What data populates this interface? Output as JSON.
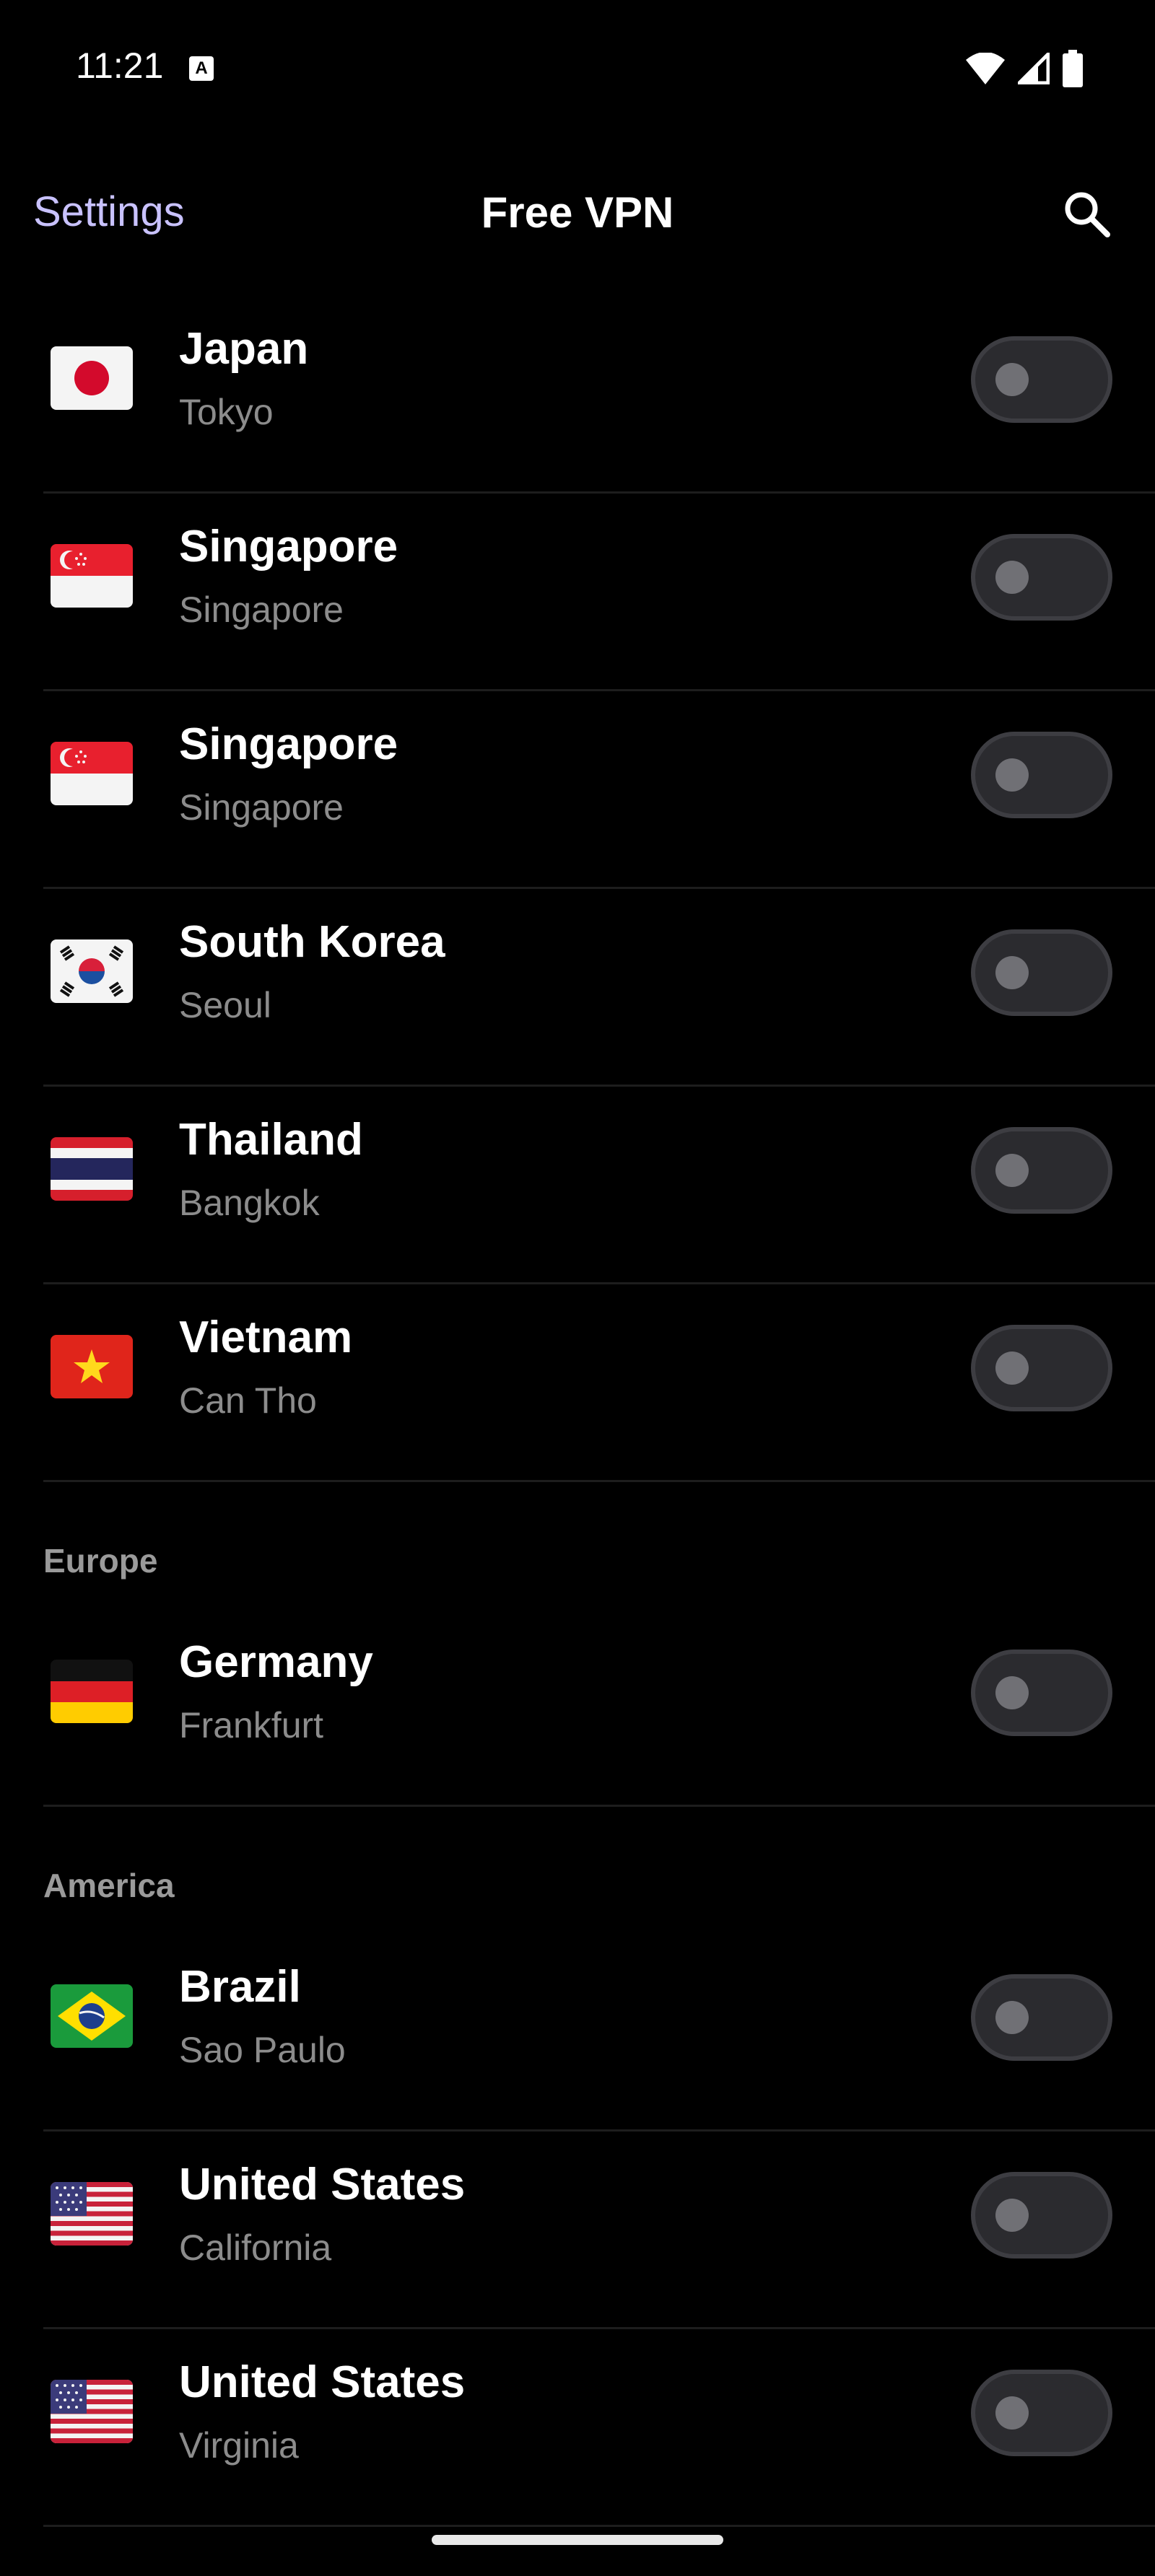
{
  "status_bar": {
    "time": "11:21",
    "notification_glyph": "A"
  },
  "app_bar": {
    "settings_label": "Settings",
    "title": "Free VPN"
  },
  "servers_asia": [
    {
      "country": "Japan",
      "city": "Tokyo",
      "flag": "jp-flag-icon",
      "enabled": false
    },
    {
      "country": "Singapore",
      "city": "Singapore",
      "flag": "sg-flag-icon",
      "enabled": false
    },
    {
      "country": "Singapore",
      "city": "Singapore",
      "flag": "sg-flag-icon",
      "enabled": false
    },
    {
      "country": "South Korea",
      "city": "Seoul",
      "flag": "kr-flag-icon",
      "enabled": false
    },
    {
      "country": "Thailand",
      "city": "Bangkok",
      "flag": "th-flag-icon",
      "enabled": false
    },
    {
      "country": "Vietnam",
      "city": "Can Tho",
      "flag": "vn-flag-icon",
      "enabled": false
    }
  ],
  "sections": {
    "europe": "Europe",
    "america": "America"
  },
  "servers_europe": [
    {
      "country": "Germany",
      "city": "Frankfurt",
      "flag": "de-flag-icon",
      "enabled": false
    }
  ],
  "servers_america": [
    {
      "country": "Brazil",
      "city": "Sao Paulo",
      "flag": "br-flag-icon",
      "enabled": false
    },
    {
      "country": "United States",
      "city": "California",
      "flag": "us-flag-icon",
      "enabled": false
    },
    {
      "country": "United States",
      "city": "Virginia",
      "flag": "us-flag-icon",
      "enabled": false
    }
  ],
  "colors": {
    "background": "#000000",
    "accent": "#c9c2ff",
    "secondary_text": "#8c8c8c",
    "toggle_off_track": "#2b2b2f"
  }
}
